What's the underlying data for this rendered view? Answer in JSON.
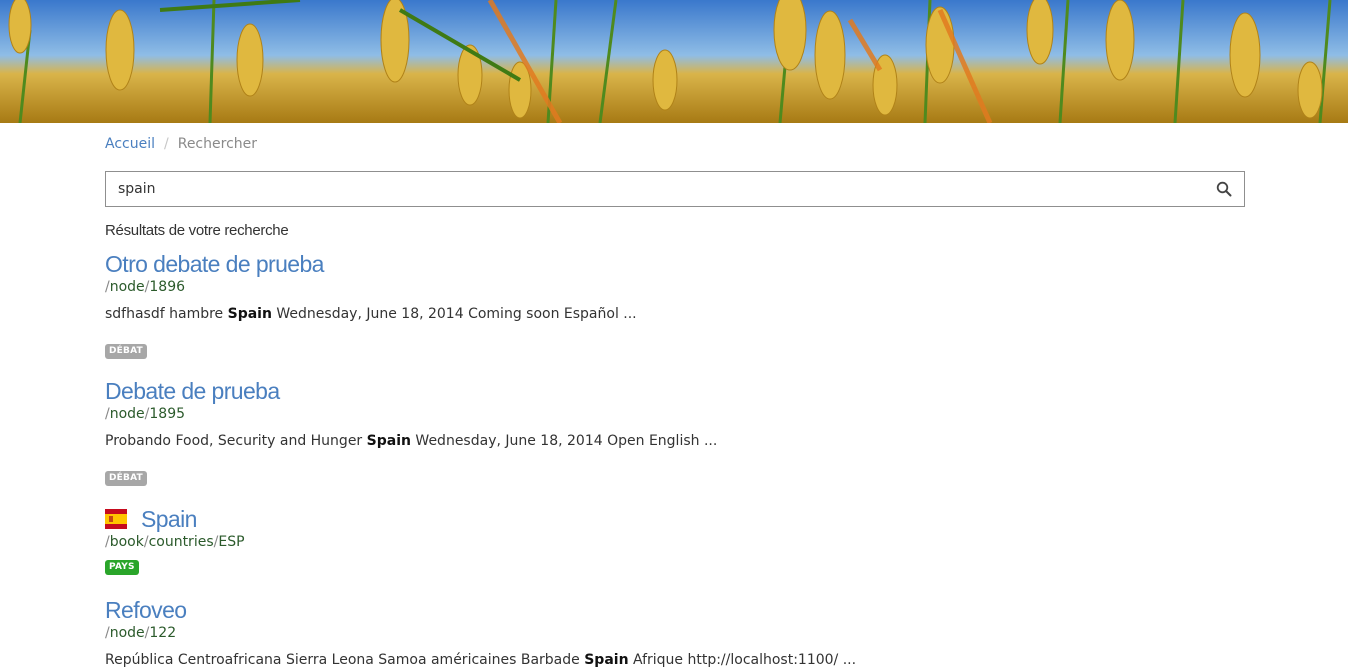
{
  "banner": {
    "name": "wheat-field-banner"
  },
  "breadcrumb": {
    "home": "Accueil",
    "separator": "/",
    "current": "Rechercher"
  },
  "search": {
    "value": "spain",
    "button_icon": "search-icon"
  },
  "results_heading": "Résultats de votre recherche",
  "results": [
    {
      "title": "Otro debate de prueba",
      "url_parts": [
        "node",
        "1896"
      ],
      "snippet_before": "sdfhasdf hambre ",
      "snippet_match": "Spain",
      "snippet_after": " Wednesday, June 18, 2014 Coming soon Español ...",
      "badge": "DÉBAT",
      "badge_color": "#a7a7a7"
    },
    {
      "title": "Debate de prueba",
      "url_parts": [
        "node",
        "1895"
      ],
      "snippet_before": "Probando Food, Security and Hunger ",
      "snippet_match": "Spain",
      "snippet_after": " Wednesday, June 18, 2014 Open English ...",
      "badge": "DÉBAT",
      "badge_color": "#a7a7a7"
    },
    {
      "title": "Spain",
      "icon": "spain-flag-icon",
      "url_parts": [
        "book",
        "countries",
        "ESP"
      ],
      "badge": "PAYS",
      "badge_color": "#2aa52a"
    },
    {
      "title": "Refoveo",
      "url_parts": [
        "node",
        "122"
      ],
      "snippet_before": "República Centroafricana Sierra Leona Samoa américaines Barbade ",
      "snippet_match": "Spain",
      "snippet_after": " Afrique http://localhost:1100/ ..."
    }
  ]
}
